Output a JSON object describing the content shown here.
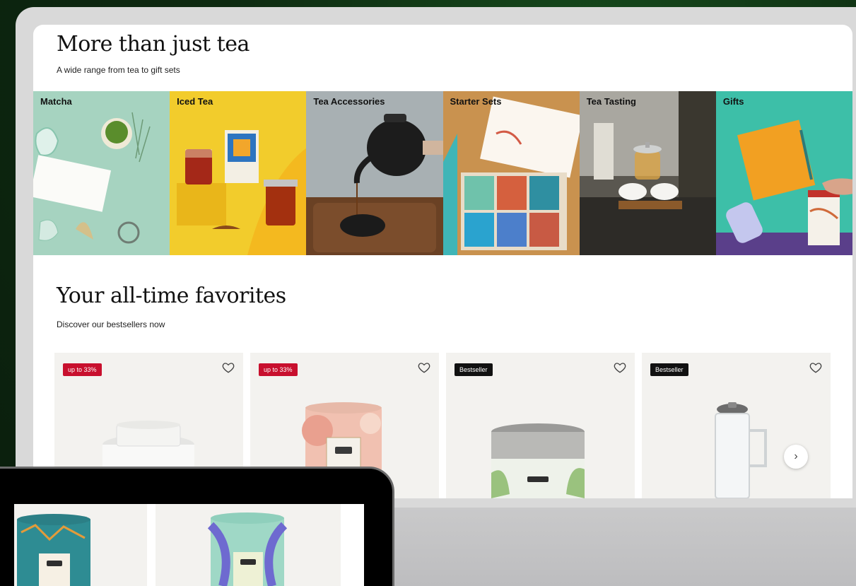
{
  "section1": {
    "title": "More than just tea",
    "subtitle": "A wide range from tea to gift sets"
  },
  "categories": [
    {
      "label": "Matcha",
      "bg": "#a6d3c0"
    },
    {
      "label": "Iced Tea",
      "bg": "#f2cc2c"
    },
    {
      "label": "Tea Accessories",
      "bg": "#a8b0b3"
    },
    {
      "label": "Starter Sets",
      "bg": "#c9924f"
    },
    {
      "label": "Tea Tasting",
      "bg": "#5a5750"
    },
    {
      "label": "Gifts",
      "bg": "#3dbfa8"
    }
  ],
  "section2": {
    "title": "Your all-time favorites",
    "subtitle": "Discover our bestsellers now"
  },
  "products": [
    {
      "badge": "up to 33%",
      "badge_style": "red"
    },
    {
      "badge": "up to 33%",
      "badge_style": "red"
    },
    {
      "badge": "Bestseller",
      "badge_style": "black"
    },
    {
      "badge": "Bestseller",
      "badge_style": "black"
    }
  ],
  "next_arrow": "›",
  "colors": {
    "sale_badge": "#c8102e",
    "bestseller_badge": "#111111",
    "card_bg": "#f3f2ef"
  }
}
